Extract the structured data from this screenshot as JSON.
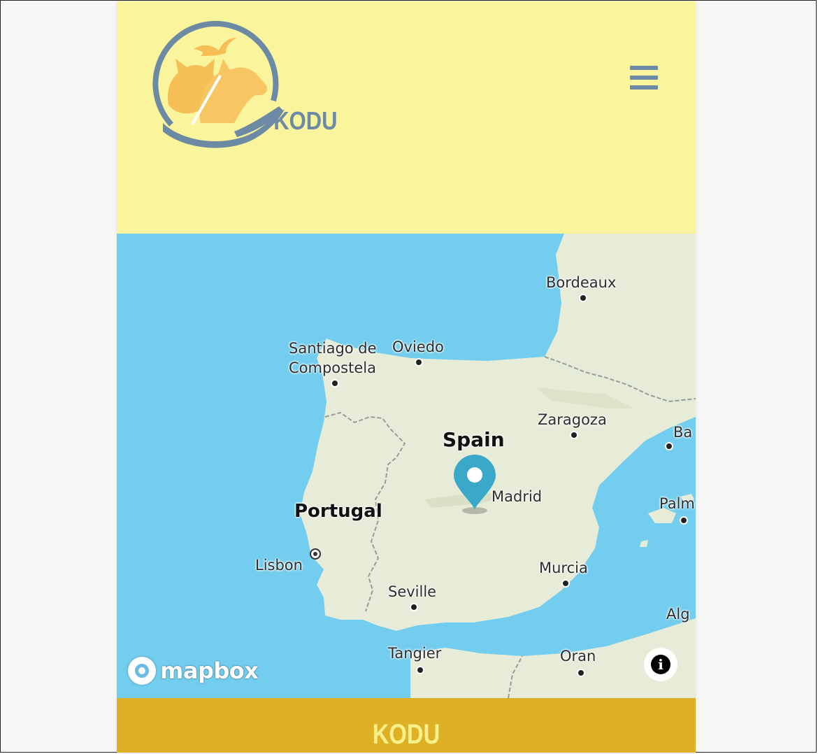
{
  "header": {
    "logo_text": "KODU",
    "menu_icon": "hamburger-menu-icon"
  },
  "map": {
    "country_labels": {
      "spain": "Spain",
      "portugal": "Portugal"
    },
    "cities": {
      "bordeaux": "Bordeaux",
      "santiago": "Santiago de\nCompostela",
      "oviedo": "Oviedo",
      "zaragoza": "Zaragoza",
      "barcelona": "Ba",
      "madrid": "Madrid",
      "palma": "Palm",
      "lisbon": "Lisbon",
      "murcia": "Murcia",
      "seville": "Seville",
      "algiers": "Alg",
      "tangier": "Tangier",
      "oran": "Oran"
    },
    "attribution_logo": "mapbox",
    "info_icon": "i",
    "marker_icon": "location-pin-icon"
  },
  "footer": {
    "title": "KODU"
  },
  "colors": {
    "header_bg": "#faf59c",
    "water": "#72cdee",
    "land": "#e6ecd8",
    "marker": "#3aa9c9",
    "footer_bg": "#ddb026",
    "footer_text": "#f7ef8a",
    "logo_blue": "#6d8aa5",
    "logo_orange": "#f5bf55"
  }
}
